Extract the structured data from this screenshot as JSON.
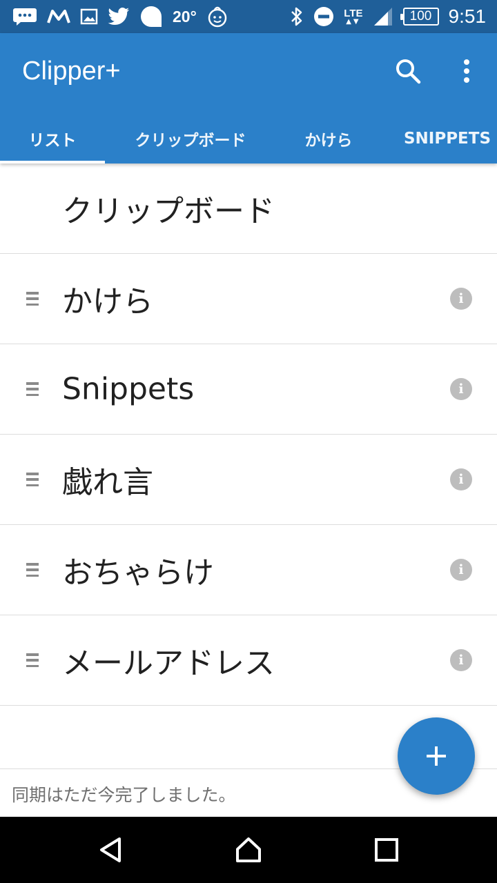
{
  "status_bar": {
    "left_icons": [
      "chat-icon",
      "gmail-icon",
      "image-icon",
      "twitter-icon",
      "bubble-icon"
    ],
    "temperature": "20°",
    "weather_icon": "face-icon",
    "right_icons": [
      "bluetooth-icon",
      "do-not-disturb-icon"
    ],
    "network": "LTE",
    "battery": "100",
    "time": "9:51"
  },
  "app_bar": {
    "title": "Clipper+",
    "search_icon": "search-icon",
    "menu_icon": "more-vert-icon",
    "color": "#2b80c9"
  },
  "tabs": [
    {
      "label": "リスト",
      "selected": true
    },
    {
      "label": "クリップボード",
      "selected": false
    },
    {
      "label": "かけら",
      "selected": false
    },
    {
      "label": "SNIPPETS",
      "selected": false
    }
  ],
  "list": {
    "items": [
      {
        "label": "クリップボード",
        "draggable": false,
        "info": false
      },
      {
        "label": "かけら",
        "draggable": true,
        "info": true
      },
      {
        "label": "Snippets",
        "draggable": true,
        "info": true
      },
      {
        "label": "戯れ言",
        "draggable": true,
        "info": true
      },
      {
        "label": "おちゃらけ",
        "draggable": true,
        "info": true
      },
      {
        "label": "メールアドレス",
        "draggable": true,
        "info": true
      }
    ]
  },
  "footer": {
    "status": "同期はただ今完了しました。"
  },
  "fab": {
    "icon": "plus-icon"
  },
  "nav_bar": {
    "icons": [
      "back-icon",
      "home-icon",
      "recents-icon"
    ]
  }
}
